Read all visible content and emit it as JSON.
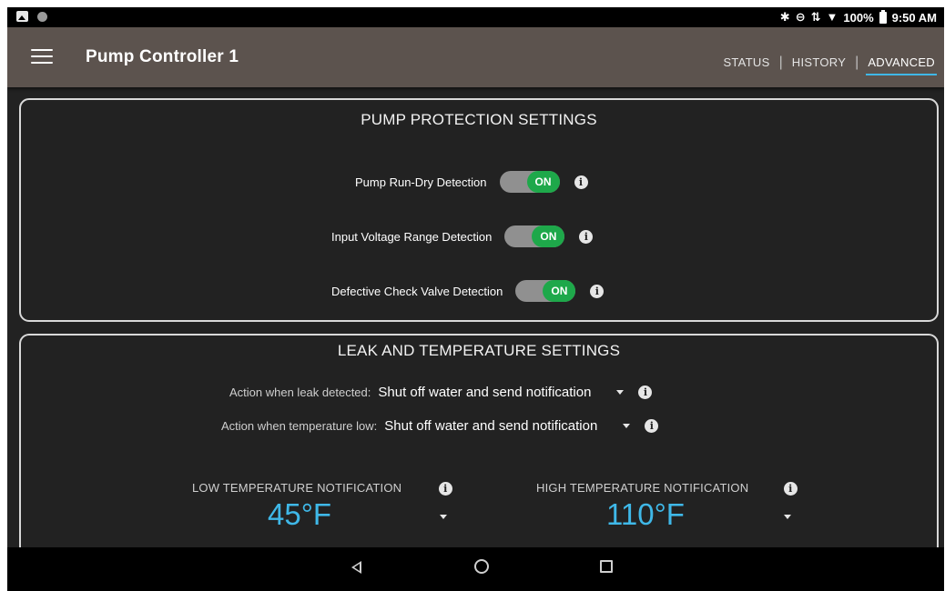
{
  "status_bar": {
    "icons_left": [
      "gallery-icon",
      "notification-dot-icon"
    ],
    "icons_right": [
      "bluetooth-icon",
      "do-not-disturb-icon",
      "data-arrows-icon",
      "wifi-icon",
      "battery-icon"
    ],
    "battery": "100%",
    "time": "9:50 AM"
  },
  "header": {
    "title": "Pump Controller 1",
    "tabs": [
      {
        "label": "STATUS"
      },
      {
        "label": "HISTORY"
      },
      {
        "label": "ADVANCED",
        "active": true
      }
    ],
    "accent_color": "#3fb8e8"
  },
  "protection": {
    "title": "PUMP PROTECTION SETTINGS",
    "toggles": [
      {
        "label": "Pump Run-Dry Detection",
        "state": "ON"
      },
      {
        "label": "Input Voltage Range Detection",
        "state": "ON"
      },
      {
        "label": "Defective Check Valve Detection",
        "state": "ON"
      }
    ],
    "toggle_on_color": "#1ea84a"
  },
  "leak_temp": {
    "title": "LEAK AND TEMPERATURE SETTINGS",
    "leak_action": {
      "label": "Action when leak detected:",
      "value": "Shut off water and send notification"
    },
    "temp_low_action": {
      "label": "Action when temperature low:",
      "value": "Shut off water and send notification"
    },
    "low_temp": {
      "label": "LOW TEMPERATURE NOTIFICATION",
      "value": "45°F"
    },
    "high_temp": {
      "label": "HIGH TEMPERATURE NOTIFICATION",
      "value": "110°F"
    }
  },
  "nav_bar": {
    "buttons": [
      "back-icon",
      "home-icon",
      "recents-icon"
    ]
  }
}
